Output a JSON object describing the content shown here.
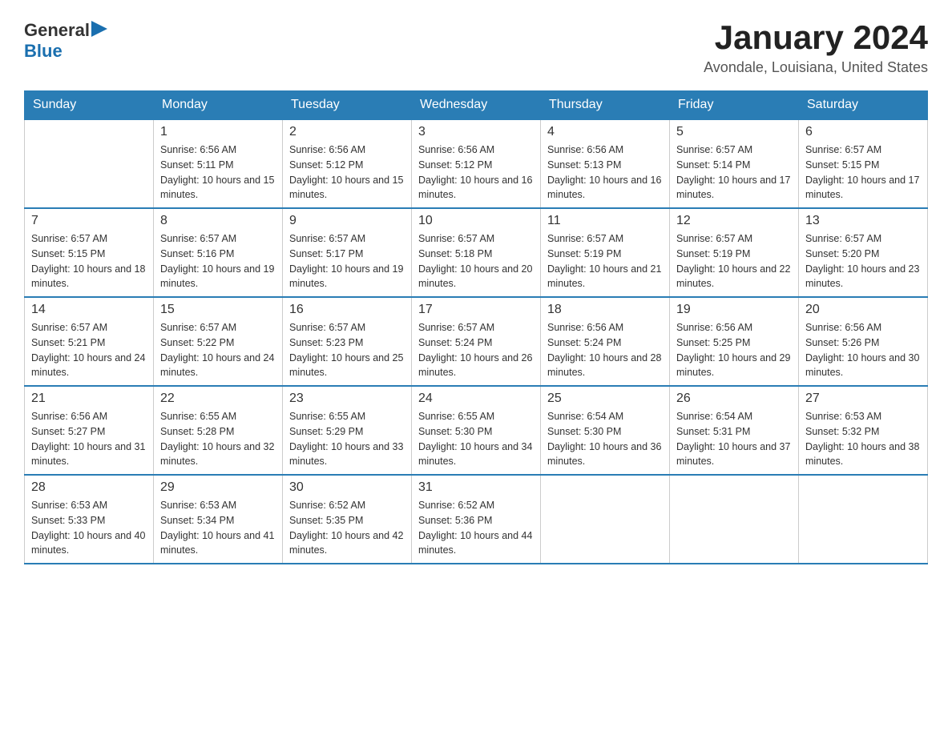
{
  "header": {
    "logo_general": "General",
    "logo_blue": "Blue",
    "month_title": "January 2024",
    "location": "Avondale, Louisiana, United States"
  },
  "days_of_week": [
    "Sunday",
    "Monday",
    "Tuesday",
    "Wednesday",
    "Thursday",
    "Friday",
    "Saturday"
  ],
  "weeks": [
    [
      {
        "day": "",
        "sunrise": "",
        "sunset": "",
        "daylight": ""
      },
      {
        "day": "1",
        "sunrise": "Sunrise: 6:56 AM",
        "sunset": "Sunset: 5:11 PM",
        "daylight": "Daylight: 10 hours and 15 minutes."
      },
      {
        "day": "2",
        "sunrise": "Sunrise: 6:56 AM",
        "sunset": "Sunset: 5:12 PM",
        "daylight": "Daylight: 10 hours and 15 minutes."
      },
      {
        "day": "3",
        "sunrise": "Sunrise: 6:56 AM",
        "sunset": "Sunset: 5:12 PM",
        "daylight": "Daylight: 10 hours and 16 minutes."
      },
      {
        "day": "4",
        "sunrise": "Sunrise: 6:56 AM",
        "sunset": "Sunset: 5:13 PM",
        "daylight": "Daylight: 10 hours and 16 minutes."
      },
      {
        "day": "5",
        "sunrise": "Sunrise: 6:57 AM",
        "sunset": "Sunset: 5:14 PM",
        "daylight": "Daylight: 10 hours and 17 minutes."
      },
      {
        "day": "6",
        "sunrise": "Sunrise: 6:57 AM",
        "sunset": "Sunset: 5:15 PM",
        "daylight": "Daylight: 10 hours and 17 minutes."
      }
    ],
    [
      {
        "day": "7",
        "sunrise": "Sunrise: 6:57 AM",
        "sunset": "Sunset: 5:15 PM",
        "daylight": "Daylight: 10 hours and 18 minutes."
      },
      {
        "day": "8",
        "sunrise": "Sunrise: 6:57 AM",
        "sunset": "Sunset: 5:16 PM",
        "daylight": "Daylight: 10 hours and 19 minutes."
      },
      {
        "day": "9",
        "sunrise": "Sunrise: 6:57 AM",
        "sunset": "Sunset: 5:17 PM",
        "daylight": "Daylight: 10 hours and 19 minutes."
      },
      {
        "day": "10",
        "sunrise": "Sunrise: 6:57 AM",
        "sunset": "Sunset: 5:18 PM",
        "daylight": "Daylight: 10 hours and 20 minutes."
      },
      {
        "day": "11",
        "sunrise": "Sunrise: 6:57 AM",
        "sunset": "Sunset: 5:19 PM",
        "daylight": "Daylight: 10 hours and 21 minutes."
      },
      {
        "day": "12",
        "sunrise": "Sunrise: 6:57 AM",
        "sunset": "Sunset: 5:19 PM",
        "daylight": "Daylight: 10 hours and 22 minutes."
      },
      {
        "day": "13",
        "sunrise": "Sunrise: 6:57 AM",
        "sunset": "Sunset: 5:20 PM",
        "daylight": "Daylight: 10 hours and 23 minutes."
      }
    ],
    [
      {
        "day": "14",
        "sunrise": "Sunrise: 6:57 AM",
        "sunset": "Sunset: 5:21 PM",
        "daylight": "Daylight: 10 hours and 24 minutes."
      },
      {
        "day": "15",
        "sunrise": "Sunrise: 6:57 AM",
        "sunset": "Sunset: 5:22 PM",
        "daylight": "Daylight: 10 hours and 24 minutes."
      },
      {
        "day": "16",
        "sunrise": "Sunrise: 6:57 AM",
        "sunset": "Sunset: 5:23 PM",
        "daylight": "Daylight: 10 hours and 25 minutes."
      },
      {
        "day": "17",
        "sunrise": "Sunrise: 6:57 AM",
        "sunset": "Sunset: 5:24 PM",
        "daylight": "Daylight: 10 hours and 26 minutes."
      },
      {
        "day": "18",
        "sunrise": "Sunrise: 6:56 AM",
        "sunset": "Sunset: 5:24 PM",
        "daylight": "Daylight: 10 hours and 28 minutes."
      },
      {
        "day": "19",
        "sunrise": "Sunrise: 6:56 AM",
        "sunset": "Sunset: 5:25 PM",
        "daylight": "Daylight: 10 hours and 29 minutes."
      },
      {
        "day": "20",
        "sunrise": "Sunrise: 6:56 AM",
        "sunset": "Sunset: 5:26 PM",
        "daylight": "Daylight: 10 hours and 30 minutes."
      }
    ],
    [
      {
        "day": "21",
        "sunrise": "Sunrise: 6:56 AM",
        "sunset": "Sunset: 5:27 PM",
        "daylight": "Daylight: 10 hours and 31 minutes."
      },
      {
        "day": "22",
        "sunrise": "Sunrise: 6:55 AM",
        "sunset": "Sunset: 5:28 PM",
        "daylight": "Daylight: 10 hours and 32 minutes."
      },
      {
        "day": "23",
        "sunrise": "Sunrise: 6:55 AM",
        "sunset": "Sunset: 5:29 PM",
        "daylight": "Daylight: 10 hours and 33 minutes."
      },
      {
        "day": "24",
        "sunrise": "Sunrise: 6:55 AM",
        "sunset": "Sunset: 5:30 PM",
        "daylight": "Daylight: 10 hours and 34 minutes."
      },
      {
        "day": "25",
        "sunrise": "Sunrise: 6:54 AM",
        "sunset": "Sunset: 5:30 PM",
        "daylight": "Daylight: 10 hours and 36 minutes."
      },
      {
        "day": "26",
        "sunrise": "Sunrise: 6:54 AM",
        "sunset": "Sunset: 5:31 PM",
        "daylight": "Daylight: 10 hours and 37 minutes."
      },
      {
        "day": "27",
        "sunrise": "Sunrise: 6:53 AM",
        "sunset": "Sunset: 5:32 PM",
        "daylight": "Daylight: 10 hours and 38 minutes."
      }
    ],
    [
      {
        "day": "28",
        "sunrise": "Sunrise: 6:53 AM",
        "sunset": "Sunset: 5:33 PM",
        "daylight": "Daylight: 10 hours and 40 minutes."
      },
      {
        "day": "29",
        "sunrise": "Sunrise: 6:53 AM",
        "sunset": "Sunset: 5:34 PM",
        "daylight": "Daylight: 10 hours and 41 minutes."
      },
      {
        "day": "30",
        "sunrise": "Sunrise: 6:52 AM",
        "sunset": "Sunset: 5:35 PM",
        "daylight": "Daylight: 10 hours and 42 minutes."
      },
      {
        "day": "31",
        "sunrise": "Sunrise: 6:52 AM",
        "sunset": "Sunset: 5:36 PM",
        "daylight": "Daylight: 10 hours and 44 minutes."
      },
      {
        "day": "",
        "sunrise": "",
        "sunset": "",
        "daylight": ""
      },
      {
        "day": "",
        "sunrise": "",
        "sunset": "",
        "daylight": ""
      },
      {
        "day": "",
        "sunrise": "",
        "sunset": "",
        "daylight": ""
      }
    ]
  ]
}
